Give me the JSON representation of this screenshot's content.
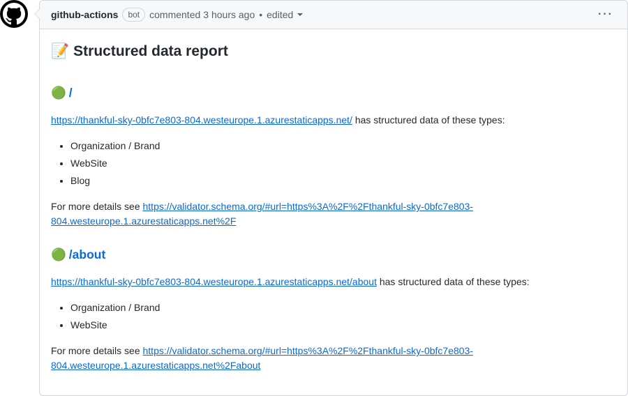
{
  "header": {
    "author": "github-actions",
    "bot_label": "bot",
    "action": "commented",
    "time": "3 hours ago",
    "edited": "edited"
  },
  "body": {
    "title_emoji": "📝",
    "title": "Structured data report",
    "sections": [
      {
        "status_emoji": "🟢",
        "path": "/",
        "url": "https://thankful-sky-0bfc7e803-804.westeurope.1.azurestaticapps.net/",
        "types_intro": "has structured data of these types:",
        "types": [
          "Organization / Brand",
          "WebSite",
          "Blog"
        ],
        "details_prefix": "For more details see",
        "details_url": "https://validator.schema.org/#url=https%3A%2F%2Fthankful-sky-0bfc7e803-804.westeurope.1.azurestaticapps.net%2F"
      },
      {
        "status_emoji": "🟢",
        "path": "/about",
        "url": "https://thankful-sky-0bfc7e803-804.westeurope.1.azurestaticapps.net/about",
        "types_intro": "has structured data of these types:",
        "types": [
          "Organization / Brand",
          "WebSite"
        ],
        "details_prefix": "For more details see",
        "details_url": "https://validator.schema.org/#url=https%3A%2F%2Fthankful-sky-0bfc7e803-804.westeurope.1.azurestaticapps.net%2Fabout"
      }
    ]
  }
}
